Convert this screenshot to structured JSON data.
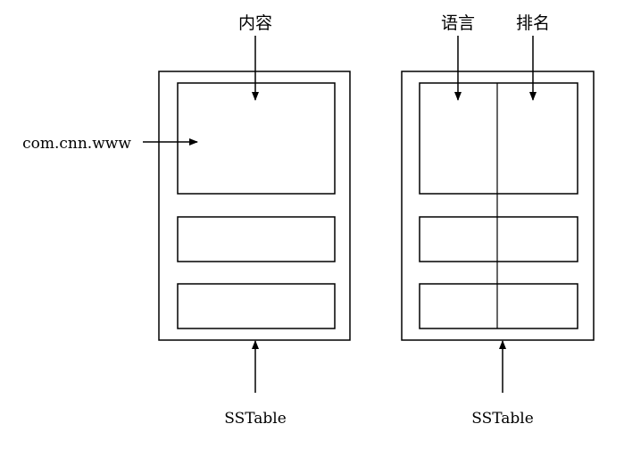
{
  "labels": {
    "content": "内容",
    "language": "语言",
    "rank": "排名",
    "row_key": "com.cnn.www",
    "sstable_left": "SSTable",
    "sstable_right": "SSTable"
  },
  "colors": {
    "stroke": "#000000",
    "background": "#ffffff"
  }
}
